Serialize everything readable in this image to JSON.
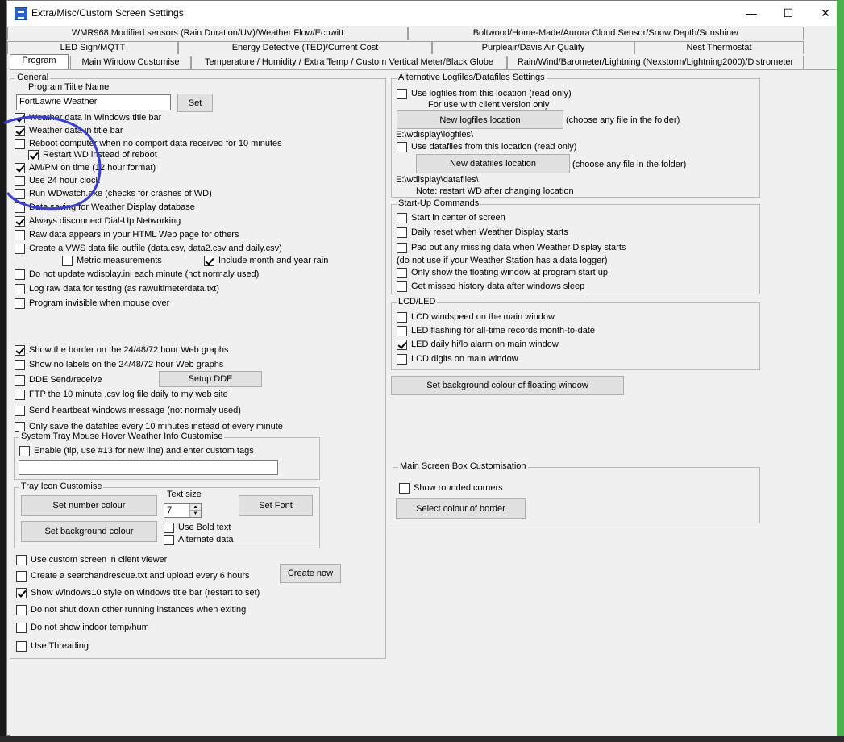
{
  "window": {
    "title": "Extra/Misc/Custom Screen Settings",
    "minimize": "—",
    "maximize": "☐",
    "close": "✕"
  },
  "tabs": {
    "row1": [
      "WMR968 Modified sensors (Rain Duration/UV)/Weather Flow/Ecowitt",
      "Boltwood/Home-Made/Aurora Cloud Sensor/Snow Depth/Sunshine/"
    ],
    "row2": [
      "LED Sign/MQTT",
      "Energy Detective (TED)/Current Cost",
      "Purpleair/Davis Air Quality",
      "Nest Thermostat"
    ],
    "row3": [
      "Program",
      "Main Window Customise",
      "Temperature / Humidity / Extra Temp / Custom Vertical Meter/Black Globe",
      "Rain/Wind/Barometer/Lightning (Nexstorm/Lightning2000)/Distrometer"
    ]
  },
  "general": {
    "label": "General",
    "title_name_label": "Program Tiitle Name",
    "title_name_value": "FortLawrie Weather",
    "set_button": "Set",
    "options": [
      {
        "label": "Weather data in Windows title bar",
        "checked": true
      },
      {
        "label": "Weather data in title bar",
        "checked": true
      },
      {
        "label": "Reboot computer when no comport data received  for 10 minutes",
        "checked": false
      },
      {
        "label": "Restart WD instead of reboot",
        "checked": true
      },
      {
        "label": "AM/PM on time (12 hour format)",
        "checked": true
      },
      {
        "label": "Use 24 hour clock",
        "checked": false
      },
      {
        "label": "Run WDwatch.exe (checks for crashes of WD)",
        "checked": false
      },
      {
        "label": "Data saving for Weather Display database",
        "checked": false
      },
      {
        "label": "Always disconnect Dial-Up Networking",
        "checked": true
      },
      {
        "label": "Raw data appears in your HTML Web page for others",
        "checked": false
      },
      {
        "label": "Create a VWS data file outfile (data.csv, data2.csv and daily.csv)",
        "checked": false
      },
      {
        "label": "Metric measurements",
        "checked": false
      },
      {
        "label": "Include month and year rain",
        "checked": true
      },
      {
        "label": "Do not update wdisplay.ini each minute (not normaly used)",
        "checked": false
      },
      {
        "label": "Log raw data for testing (as rawultimeterdata.txt)",
        "checked": false
      },
      {
        "label": "Program invisible when mouse over",
        "checked": false
      },
      {
        "label": "Show the border on the 24/48/72 hour Web graphs",
        "checked": true
      },
      {
        "label": "Show no labels on the 24/48/72 hour Web graphs",
        "checked": false
      },
      {
        "label": "DDE Send/receive",
        "checked": false
      },
      {
        "label": "FTP the 10 minute .csv log file daily to my web site",
        "checked": false
      },
      {
        "label": "Send heartbeat windows message (not normaly used)",
        "checked": false
      },
      {
        "label": "Only save the datafiles every 10 minutes instead of every minute",
        "checked": false
      }
    ],
    "setup_dde": "Setup DDE"
  },
  "systray": {
    "label": "System Tray Mouse Hover Weather Info Customise",
    "enable_label": "Enable (tip, use #13 for new line) and enter custom tags",
    "enable_checked": false,
    "input_value": ""
  },
  "trayicon": {
    "label": "Tray Icon Customise",
    "set_number_colour": "Set number colour",
    "set_background_colour": "Set background colour",
    "text_size_label": "Text size",
    "text_size_value": "7",
    "set_font": "Set Font",
    "bold_label": "Use Bold text",
    "bold_checked": false,
    "alternate_label": "Alternate data",
    "alternate_checked": false
  },
  "bottom_options": [
    {
      "label": "Use custom screen in client viewer",
      "checked": false
    },
    {
      "label": "Create a searchandrescue.txt and upload every 6 hours",
      "checked": false
    },
    {
      "label": "Show Windows10 style on windows title bar (restart to set)",
      "checked": true
    },
    {
      "label": "Do not shut down other running instances when exiting",
      "checked": false
    },
    {
      "label": "Do not show indoor temp/hum",
      "checked": false
    },
    {
      "label": "Use Threading",
      "checked": false
    }
  ],
  "create_now": "Create now",
  "altlog": {
    "label": "Alternative Logfiles/Datafiles Settings",
    "use_logfiles_label": "Use logfiles from this location (read only)",
    "use_logfiles_checked": false,
    "client_note": "For use with  client version only",
    "new_logfiles_button": "New logfiles location",
    "choose_file_1": "(choose any file in the folder)",
    "logfiles_path": "E:\\wdisplay\\logfiles\\",
    "use_datafiles_label": "Use datafiles from this location (read only)",
    "use_datafiles_checked": false,
    "new_datafiles_button": "New datafiles location",
    "choose_file_2": "(choose any file in the folder)",
    "datafiles_path": "E:\\wdisplay\\datafiles\\",
    "restart_note": "Note: restart WD after changing location"
  },
  "startup": {
    "label": "Start-Up Commands",
    "options": [
      {
        "label": "Start in center of screen",
        "checked": false
      },
      {
        "label": "Daily reset when Weather Display starts",
        "checked": false
      },
      {
        "label": "Pad out any missing data when Weather Display starts",
        "checked": false
      },
      {
        "label": "Only show the floating window at program start up",
        "checked": false
      },
      {
        "label": "Get missed history data after windows sleep",
        "checked": false
      }
    ],
    "logger_note": "(do not use if your Weather Station has a data logger)"
  },
  "lcd": {
    "label": "LCD/LED",
    "options": [
      {
        "label": "LCD windspeed on the main window",
        "checked": false
      },
      {
        "label": "LED flashing for all-time records month-to-date",
        "checked": false
      },
      {
        "label": "LED daily hi/lo alarm on main window",
        "checked": true
      },
      {
        "label": "LCD digits on main window",
        "checked": false
      }
    ]
  },
  "set_bg_floating": "Set background colour of floating window",
  "mainscreen": {
    "label": "Main Screen Box Customisation",
    "rounded_label": "Show rounded corners",
    "rounded_checked": false,
    "border_colour_button": "Select colour of border"
  },
  "colors": {
    "annotation": "#3b3fd0",
    "window_bg": "#f0f0f0"
  }
}
